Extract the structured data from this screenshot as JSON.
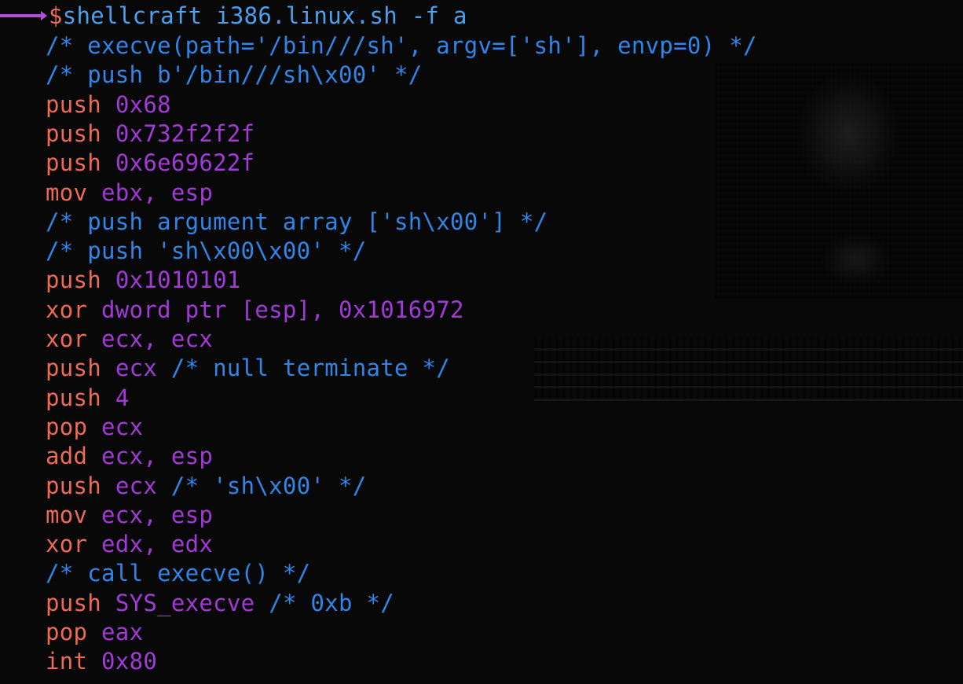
{
  "prompt": {
    "symbol": "$",
    "command": "shellcraft i386.linux.sh -f a"
  },
  "lines": [
    {
      "kind": "comment",
      "text": "/* execve(path='/bin///sh', argv=['sh'], envp=0) */"
    },
    {
      "kind": "comment",
      "text": "/* push b'/bin///sh\\x00' */"
    },
    {
      "kind": "code",
      "ins": "push",
      "arg": "0x68"
    },
    {
      "kind": "code",
      "ins": "push",
      "arg": "0x732f2f2f"
    },
    {
      "kind": "code",
      "ins": "push",
      "arg": "0x6e69622f"
    },
    {
      "kind": "code",
      "ins": "mov",
      "arg": "ebx, esp"
    },
    {
      "kind": "comment",
      "text": "/* push argument array ['sh\\x00'] */"
    },
    {
      "kind": "comment",
      "text": "/* push 'sh\\x00\\x00' */"
    },
    {
      "kind": "code",
      "ins": "push",
      "arg": "0x1010101"
    },
    {
      "kind": "code",
      "ins": "xor",
      "arg": "dword ptr [esp], 0x1016972"
    },
    {
      "kind": "code",
      "ins": "xor",
      "arg": "ecx, ecx"
    },
    {
      "kind": "code",
      "ins": "push",
      "arg": "ecx",
      "comment": "/* null terminate */"
    },
    {
      "kind": "code",
      "ins": "push",
      "arg": "4"
    },
    {
      "kind": "code",
      "ins": "pop",
      "arg": "ecx"
    },
    {
      "kind": "code",
      "ins": "add",
      "arg": "ecx, esp"
    },
    {
      "kind": "code",
      "ins": "push",
      "arg": "ecx",
      "comment": "/* 'sh\\x00' */"
    },
    {
      "kind": "code",
      "ins": "mov",
      "arg": "ecx, esp"
    },
    {
      "kind": "code",
      "ins": "xor",
      "arg": "edx, edx"
    },
    {
      "kind": "comment",
      "text": "/* call execve() */"
    },
    {
      "kind": "code",
      "ins": "push",
      "arg": "SYS_execve",
      "comment": "/* 0xb */"
    },
    {
      "kind": "code",
      "ins": "pop",
      "arg": "eax"
    },
    {
      "kind": "code",
      "ins": "int",
      "arg": "0x80"
    }
  ],
  "colors": {
    "background": "#080808",
    "prompt": "#f06a58",
    "command": "#4aa1f0",
    "comment": "#2f86e8",
    "instruction": "#ef6a55",
    "argument": "#a23ad8",
    "prompt_arrow": "#b44dd8"
  }
}
